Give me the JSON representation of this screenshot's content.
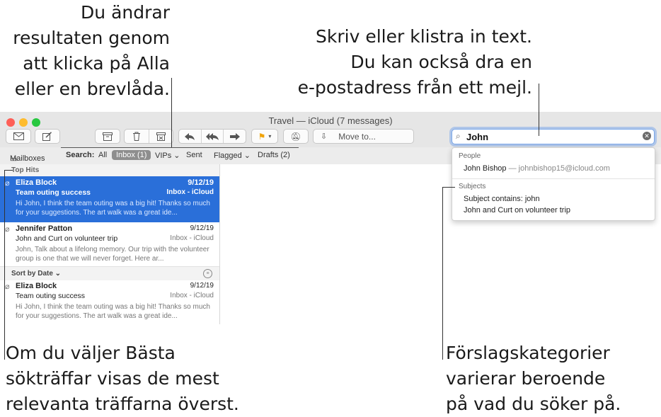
{
  "callouts": {
    "top_left": "Du ändrar\nresultaten genom\natt klicka på Alla\neller en brevlåda.",
    "top_right": "Skriv eller klistra in text.\nDu kan också dra en\ne-postadress från ett mejl.",
    "bottom_left": "Om du väljer Bästa\nsökträffar visas de mest\nrelevanta träffarna överst.",
    "bottom_right": "Förslagskategorier\nvarierar beroende\npå vad du söker på."
  },
  "window": {
    "title": "Travel — iCloud (7 messages)"
  },
  "toolbar": {
    "move_to": "Move to..."
  },
  "search": {
    "query": "John"
  },
  "scope_bar": {
    "mailboxes": "Mailboxes",
    "search_label": "Search:",
    "all": "All",
    "inbox": "Inbox (1)",
    "vips": "VIPs ⌄",
    "sent": "Sent",
    "flagged": "Flagged ⌄",
    "drafts": "Drafts (2)"
  },
  "list": {
    "top_hits": "Top Hits",
    "sort_by": "Sort by Date ⌄",
    "messages": [
      {
        "from": "Eliza Block",
        "date": "9/12/19",
        "subject": "Team outing success",
        "mailbox": "Inbox - iCloud",
        "preview": "Hi John, I think the team outing was a big hit! Thanks so much for your suggestions. The art walk was a great ide..."
      },
      {
        "from": "Jennifer Patton",
        "date": "9/12/19",
        "subject": "John and Curt on volunteer trip",
        "mailbox": "Inbox - iCloud",
        "preview": "John, Talk about a lifelong memory. Our trip with the volunteer group is one that we will never forget. Here ar..."
      },
      {
        "from": "Eliza Block",
        "date": "9/12/19",
        "subject": "Team outing success",
        "mailbox": "Inbox - iCloud",
        "preview": "Hi John, I think the team outing was a big hit! Thanks so much for your suggestions. The art walk was a great ide..."
      }
    ]
  },
  "suggestions": {
    "people_header": "People",
    "person": "John Bishop",
    "person_email": "— johnbishop15@icloud.com",
    "subjects_header": "Subjects",
    "subject_1": "Subject contains: john",
    "subject_2": "John and Curt on volunteer trip"
  },
  "colors": {
    "selection": "#2a6fd9",
    "accent_flag": "#f0a30a",
    "red": "#fe5f57",
    "yellow": "#febc2e",
    "green": "#28c840"
  }
}
